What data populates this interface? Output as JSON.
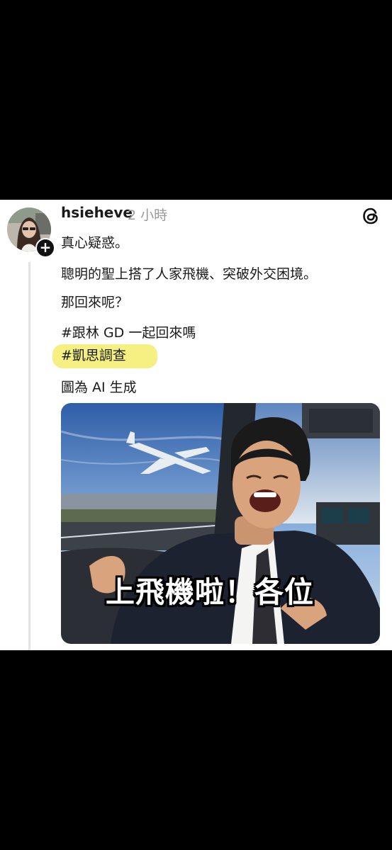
{
  "post": {
    "username": "hsieheve",
    "timestamp": "2 小時",
    "follow_symbol": "+",
    "lines": [
      "真心疑惑。",
      "聰明的聖上搭了人家飛機、突破外交困境。",
      "那回來呢？",
      "#跟林 GD 一起回來嗎",
      "#凱思調查",
      "圖為 AI 生成"
    ],
    "image_caption": "上飛機啦！各位"
  },
  "icons": {
    "app_logo": "threads-logo-icon",
    "follow": "plus-icon"
  },
  "colors": {
    "highlight": "#f4ec5f",
    "background": "#000000",
    "card": "#ffffff"
  }
}
